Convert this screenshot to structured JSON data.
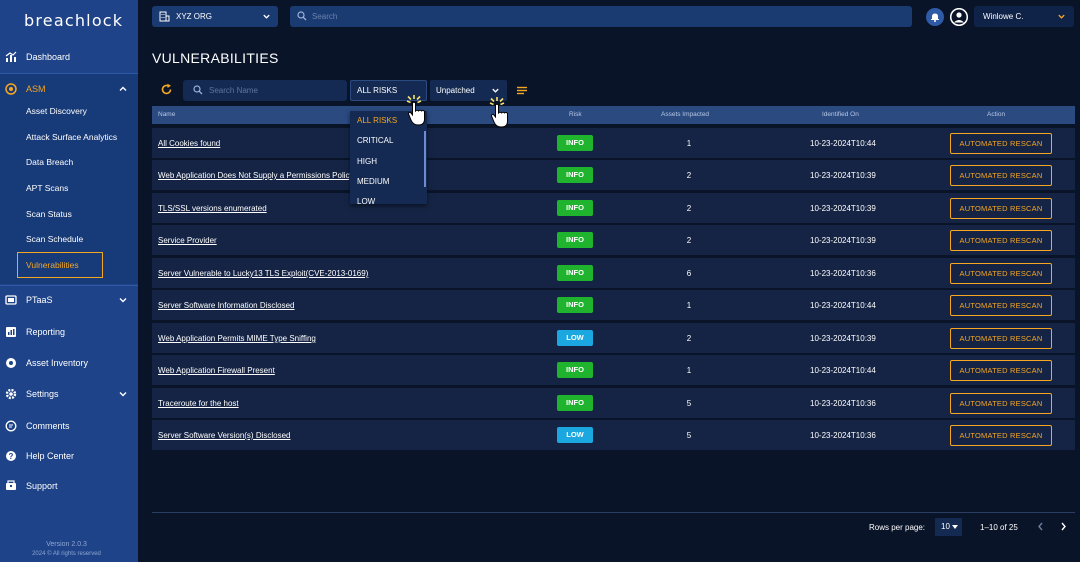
{
  "app": {
    "logo_text": "breachlock",
    "version": "Version 2.0.3",
    "copyright": "2024 © All rights reserved"
  },
  "sidebar": {
    "items": [
      {
        "label": "Dashboard",
        "icon": "chart-icon"
      },
      {
        "label": "ASM",
        "icon": "target-icon",
        "expanded": true
      },
      {
        "label": "PTaaS",
        "icon": "ptaas-icon"
      },
      {
        "label": "Reporting",
        "icon": "report-icon"
      },
      {
        "label": "Asset Inventory",
        "icon": "inventory-icon"
      },
      {
        "label": "Settings",
        "icon": "gear-icon"
      },
      {
        "label": "Comments",
        "icon": "comment-icon"
      },
      {
        "label": "Help Center",
        "icon": "help-icon"
      },
      {
        "label": "Support",
        "icon": "support-icon"
      }
    ],
    "asm_subitems": [
      {
        "label": "Asset Discovery"
      },
      {
        "label": "Attack Surface Analytics"
      },
      {
        "label": "Data Breach"
      },
      {
        "label": "APT Scans"
      },
      {
        "label": "Scan Status"
      },
      {
        "label": "Scan Schedule"
      },
      {
        "label": "Vulnerabilities",
        "active": true
      }
    ]
  },
  "topbar": {
    "org": "XYZ ORG",
    "search_placeholder": "Search",
    "user_name": "Winlowe C."
  },
  "main": {
    "title": "VULNERABILITIES",
    "search_placeholder": "Search Name",
    "risk_filter": "ALL RISKS",
    "patch_filter": "Unpatched",
    "risk_options": [
      "ALL RISKS",
      "CRITICAL",
      "HIGH",
      "MEDIUM",
      "LOW"
    ],
    "columns": {
      "name": "Name",
      "risk": "Risk",
      "assets": "Assets Impacted",
      "identified": "Identified On",
      "action": "Action"
    },
    "rows": [
      {
        "name": "All Cookies found",
        "risk": "INFO",
        "assets": "1",
        "date": "10-23-2024T10:44",
        "action": "AUTOMATED RESCAN"
      },
      {
        "name": "Web Application Does Not Supply a Permissions Policy",
        "risk": "INFO",
        "assets": "2",
        "date": "10-23-2024T10:39",
        "action": "AUTOMATED RESCAN"
      },
      {
        "name": "TLS/SSL versions enumerated",
        "risk": "INFO",
        "assets": "2",
        "date": "10-23-2024T10:39",
        "action": "AUTOMATED RESCAN"
      },
      {
        "name": "Service Provider",
        "risk": "INFO",
        "assets": "2",
        "date": "10-23-2024T10:39",
        "action": "AUTOMATED RESCAN"
      },
      {
        "name": "Server Vulnerable to Lucky13 TLS Exploit(CVE-2013-0169)",
        "risk": "INFO",
        "assets": "6",
        "date": "10-23-2024T10:36",
        "action": "AUTOMATED RESCAN"
      },
      {
        "name": "Server Software Information Disclosed",
        "risk": "INFO",
        "assets": "1",
        "date": "10-23-2024T10:44",
        "action": "AUTOMATED RESCAN"
      },
      {
        "name": "Web Application Permits MIME Type Sniffing",
        "risk": "LOW",
        "assets": "2",
        "date": "10-23-2024T10:39",
        "action": "AUTOMATED RESCAN"
      },
      {
        "name": "Web Application Firewall Present",
        "risk": "INFO",
        "assets": "1",
        "date": "10-23-2024T10:44",
        "action": "AUTOMATED RESCAN"
      },
      {
        "name": "Traceroute for the host",
        "risk": "INFO",
        "assets": "5",
        "date": "10-23-2024T10:36",
        "action": "AUTOMATED RESCAN"
      },
      {
        "name": "Server Software Version(s) Disclosed",
        "risk": "LOW",
        "assets": "5",
        "date": "10-23-2024T10:36",
        "action": "AUTOMATED RESCAN"
      }
    ]
  },
  "pagination": {
    "rows_label": "Rows per page:",
    "rows_value": "10",
    "range": "1–10 of 25"
  },
  "colors": {
    "sidebar": "#1e4388",
    "accent": "#f5a623",
    "info": "#1fb32e",
    "low": "#1ba7e0",
    "background": "#0a1428"
  }
}
